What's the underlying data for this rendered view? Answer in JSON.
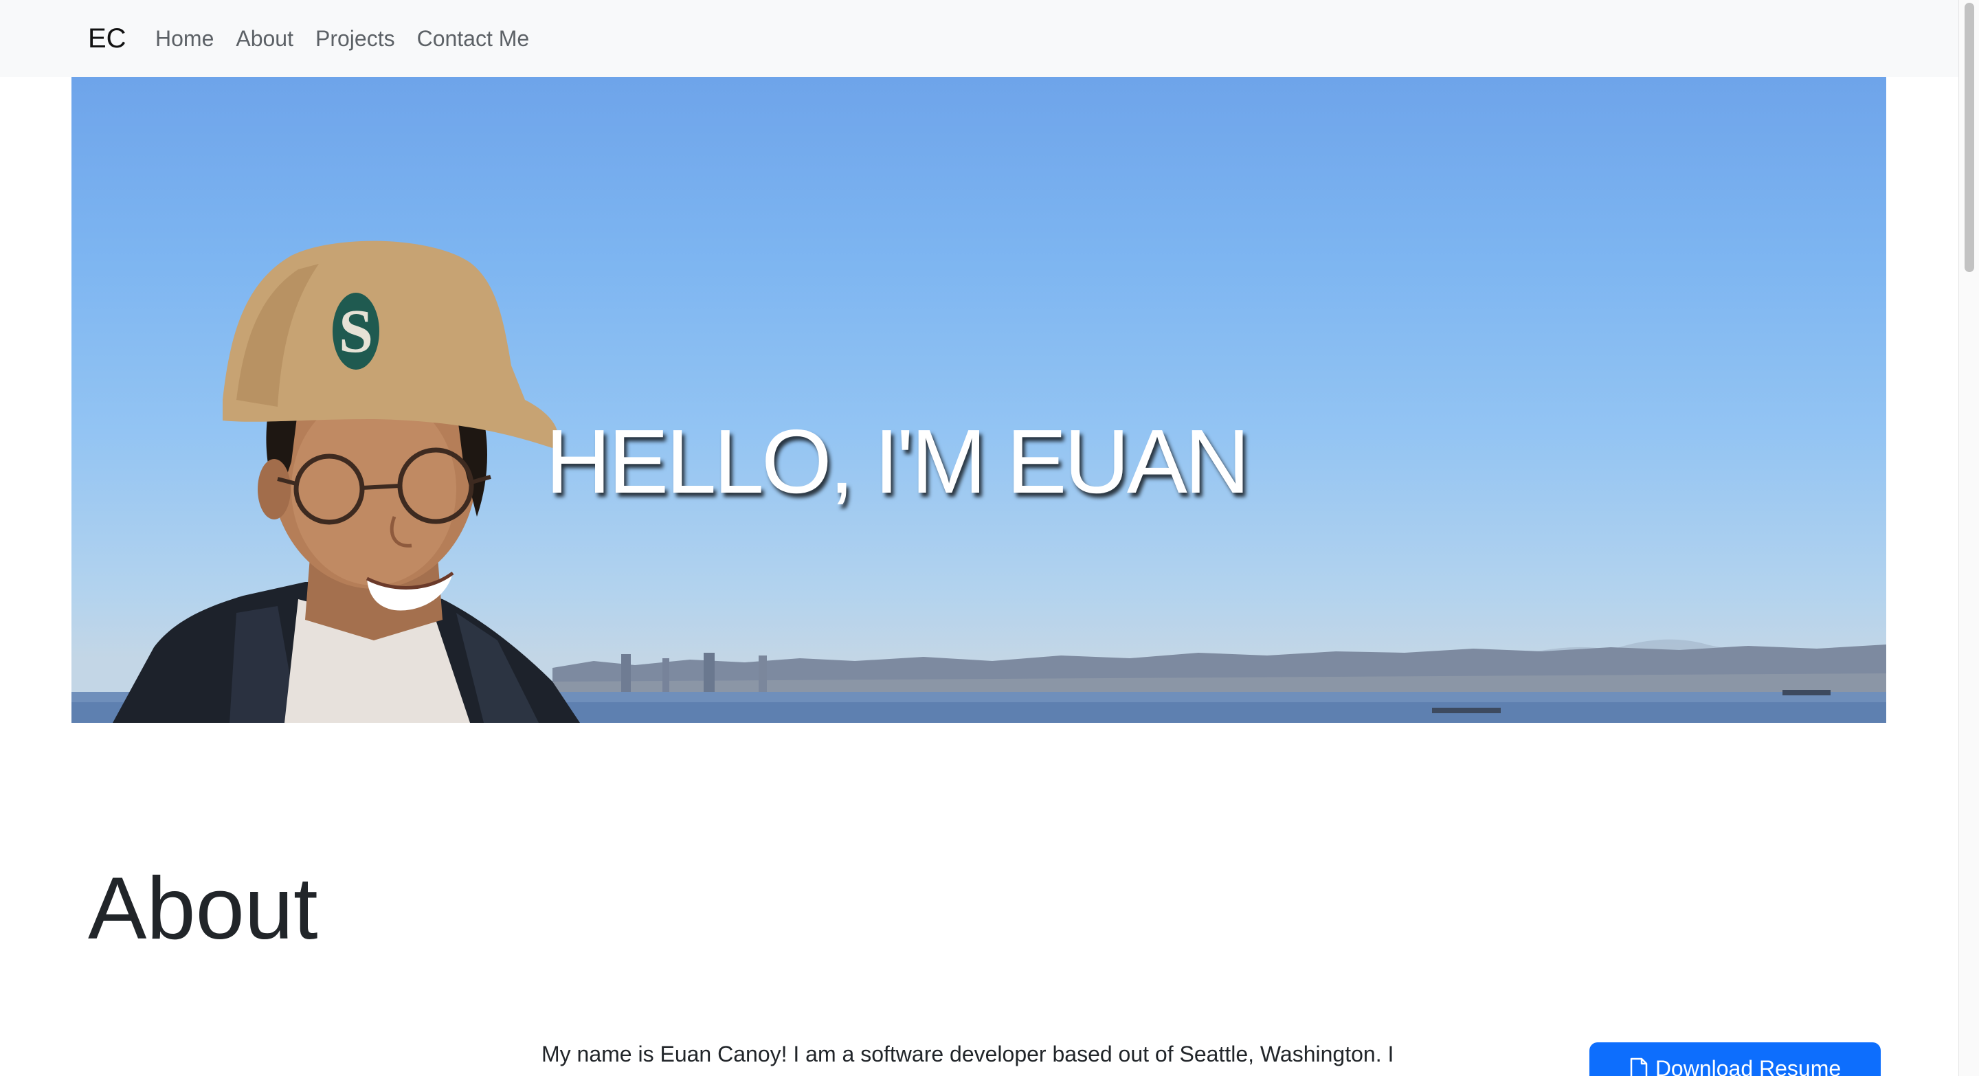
{
  "navbar": {
    "brand": "EC",
    "links": [
      "Home",
      "About",
      "Projects",
      "Contact Me"
    ]
  },
  "hero": {
    "title": "HELLO, I'M EUAN",
    "image": "portrait-photo-with-city-skyline"
  },
  "about": {
    "heading": "About",
    "text": "My name is Euan Canoy! I am a software developer based out of Seattle, Washington. I",
    "download_button": {
      "label": "Download Resume",
      "icon": "file-icon"
    }
  },
  "colors": {
    "navbar_bg": "#f8f9fa",
    "button_primary": "#0d6efd",
    "text": "#212529",
    "nav_text": "#5c6166"
  }
}
